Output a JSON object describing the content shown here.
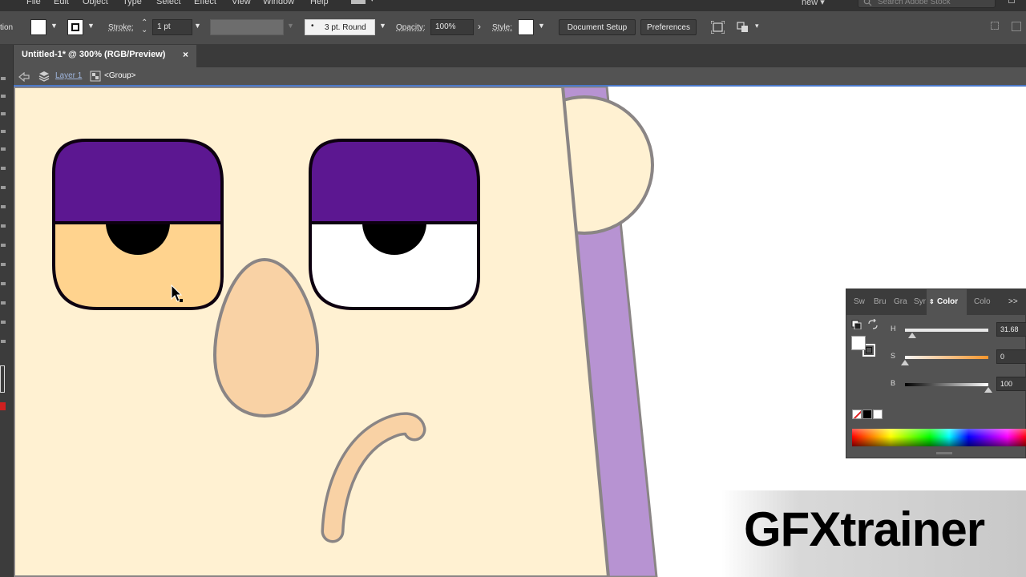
{
  "menu": {
    "items": [
      "File",
      "Edit",
      "Object",
      "Type",
      "Select",
      "Effect",
      "View",
      "Window",
      "Help"
    ],
    "workspace": "new",
    "stock_search_placeholder": "Search Adobe Stock"
  },
  "control_bar": {
    "left_label": "tion",
    "stroke_label": "Stroke:",
    "stroke_value": "1 pt",
    "brush_value": "3 pt. Round",
    "opacity_label": "Opacity:",
    "opacity_value": "100%",
    "style_label": "Style:",
    "document_setup": "Document Setup",
    "preferences": "Preferences"
  },
  "document": {
    "tab_title": "Untitled-1* @ 300% (RGB/Preview)",
    "close_symbol": "×"
  },
  "breadcrumb": {
    "layer": "Layer 1",
    "group": "<Group>"
  },
  "color_panel": {
    "tabs": [
      "Sw",
      "Bru",
      "Gra",
      "Syr",
      "Color",
      "Colo"
    ],
    "active_tab": "Color",
    "more_symbol": ">>",
    "H": {
      "label": "H",
      "value": "31.68",
      "fraction": 0.088
    },
    "S": {
      "label": "S",
      "value": "0",
      "fraction": 0.0
    },
    "B": {
      "label": "B",
      "value": "100",
      "fraction": 1.0
    }
  },
  "watermark": "GFXtrainer",
  "colors": {
    "skin": "#fff1d2",
    "eyelid": "#5c1791",
    "left_eye_fill": "#ffd38e",
    "nose": "#f9d2a5",
    "hair": "#b793d2",
    "stroke": "#8a8585"
  }
}
